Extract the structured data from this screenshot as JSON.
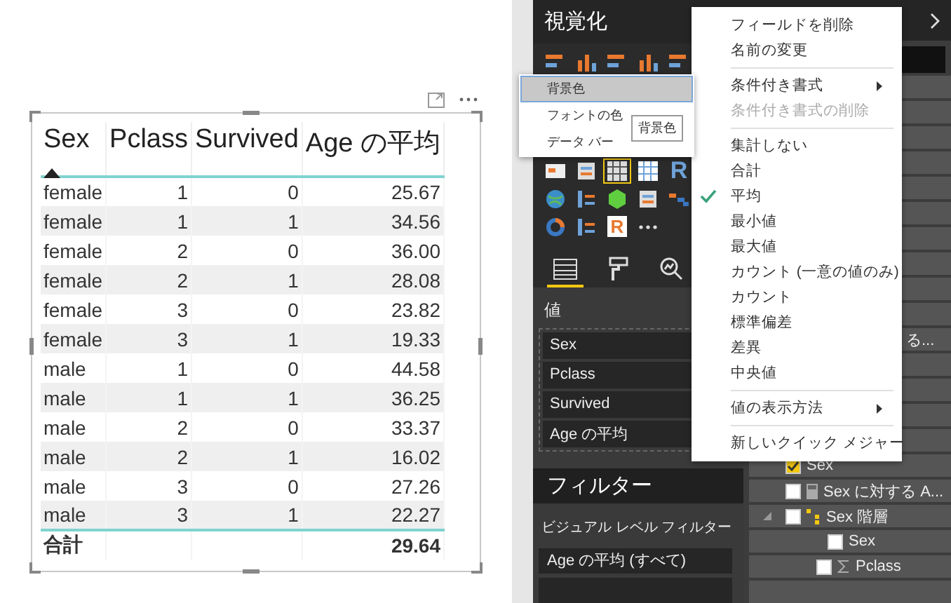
{
  "table_visual": {
    "columns": [
      {
        "label": "Sex",
        "sorted": true
      },
      {
        "label": "Pclass",
        "sorted": false
      },
      {
        "label": "Survived",
        "sorted": false
      },
      {
        "label": "Age の平均",
        "sorted": false
      }
    ],
    "rows": [
      [
        "female",
        "1",
        "0",
        "25.67"
      ],
      [
        "female",
        "1",
        "1",
        "34.56"
      ],
      [
        "female",
        "2",
        "0",
        "36.00"
      ],
      [
        "female",
        "2",
        "1",
        "28.08"
      ],
      [
        "female",
        "3",
        "0",
        "23.82"
      ],
      [
        "female",
        "3",
        "1",
        "19.33"
      ],
      [
        "male",
        "1",
        "0",
        "44.58"
      ],
      [
        "male",
        "1",
        "1",
        "36.25"
      ],
      [
        "male",
        "2",
        "0",
        "33.37"
      ],
      [
        "male",
        "2",
        "1",
        "16.02"
      ],
      [
        "male",
        "3",
        "0",
        "27.26"
      ],
      [
        "male",
        "3",
        "1",
        "22.27"
      ]
    ],
    "total": {
      "label": "合計",
      "value": "29.64"
    }
  },
  "visualizations": {
    "title": "視覚化",
    "icons": [
      {
        "kind": "hbar",
        "selected": false
      },
      {
        "kind": "col",
        "selected": false
      },
      {
        "kind": "hbar",
        "selected": false
      },
      {
        "kind": "col",
        "selected": false
      },
      {
        "kind": "hbar",
        "selected": false
      },
      {
        "kind": "card",
        "selected": false
      },
      {
        "kind": "slicer",
        "selected": false
      },
      {
        "kind": "table",
        "selected": true
      },
      {
        "kind": "matrix",
        "selected": false
      },
      {
        "kind": "r",
        "label": "R",
        "selected": false
      },
      {
        "kind": "globe",
        "selected": false
      },
      {
        "kind": "kpi",
        "selected": false
      },
      {
        "kind": "hex",
        "selected": false
      },
      {
        "kind": "slicer",
        "selected": false
      },
      {
        "kind": "waterfall",
        "selected": false
      },
      {
        "kind": "donut",
        "selected": false
      },
      {
        "kind": "kpi",
        "selected": false
      },
      {
        "kind": "rbox",
        "label": "R",
        "selected": false
      },
      {
        "kind": "more",
        "selected": false
      }
    ],
    "tabs": [
      {
        "kind": "fields",
        "selected": true
      },
      {
        "kind": "format",
        "selected": false
      },
      {
        "kind": "analytics",
        "selected": false
      }
    ],
    "values_label": "値",
    "values": [
      "Sex",
      "Pclass",
      "Survived",
      "Age の平均"
    ]
  },
  "filters": {
    "title": "フィルター",
    "section": "ビジュアル レベル フィルター",
    "items": [
      "Age の平均 (すべて)"
    ]
  },
  "fields": {
    "rows": [
      {
        "kind": "plain",
        "label": "る..."
      },
      {
        "kind": "field",
        "label": "Sex",
        "checked": true
      },
      {
        "kind": "measure",
        "label": "Sex に対する A...",
        "checked": false
      },
      {
        "kind": "hierarchy",
        "label": "Sex 階層",
        "checked": false,
        "expanded": true,
        "children": [
          {
            "kind": "field",
            "label": "Sex",
            "checked": false
          },
          {
            "kind": "sum",
            "label": "Pclass",
            "checked": false
          }
        ]
      }
    ]
  },
  "context_menu": {
    "items": [
      {
        "kind": "item",
        "label": "フィールドを削除",
        "disabled": false,
        "checked": false,
        "submenu": false
      },
      {
        "kind": "item",
        "label": "名前の変更",
        "disabled": false,
        "checked": false,
        "submenu": false
      },
      {
        "kind": "separator"
      },
      {
        "kind": "item",
        "label": "条件付き書式",
        "disabled": false,
        "checked": false,
        "submenu": true
      },
      {
        "kind": "item",
        "label": "条件付き書式の削除",
        "disabled": true,
        "checked": false,
        "submenu": false
      },
      {
        "kind": "separator"
      },
      {
        "kind": "item",
        "label": "集計しない",
        "disabled": false,
        "checked": false,
        "submenu": false
      },
      {
        "kind": "item",
        "label": "合計",
        "disabled": false,
        "checked": false,
        "submenu": false
      },
      {
        "kind": "item",
        "label": "平均",
        "disabled": false,
        "checked": true,
        "submenu": false
      },
      {
        "kind": "item",
        "label": "最小値",
        "disabled": false,
        "checked": false,
        "submenu": false
      },
      {
        "kind": "item",
        "label": "最大値",
        "disabled": false,
        "checked": false,
        "submenu": false
      },
      {
        "kind": "item",
        "label": "カウント (一意の値のみ)",
        "disabled": false,
        "checked": false,
        "submenu": false
      },
      {
        "kind": "item",
        "label": "カウント",
        "disabled": false,
        "checked": false,
        "submenu": false
      },
      {
        "kind": "item",
        "label": "標準偏差",
        "disabled": false,
        "checked": false,
        "submenu": false
      },
      {
        "kind": "item",
        "label": "差異",
        "disabled": false,
        "checked": false,
        "submenu": false
      },
      {
        "kind": "item",
        "label": "中央値",
        "disabled": false,
        "checked": false,
        "submenu": false
      },
      {
        "kind": "separator"
      },
      {
        "kind": "item",
        "label": "値の表示方法",
        "disabled": false,
        "checked": false,
        "submenu": true
      },
      {
        "kind": "separator"
      },
      {
        "kind": "item",
        "label": "新しいクイック メジャー",
        "disabled": false,
        "checked": false,
        "submenu": false
      }
    ]
  },
  "submenu": {
    "items": [
      {
        "label": "背景色",
        "selected": true
      },
      {
        "label": "フォントの色",
        "selected": false
      },
      {
        "label": "データ バー",
        "selected": false
      }
    ],
    "tooltip": "背景色"
  }
}
